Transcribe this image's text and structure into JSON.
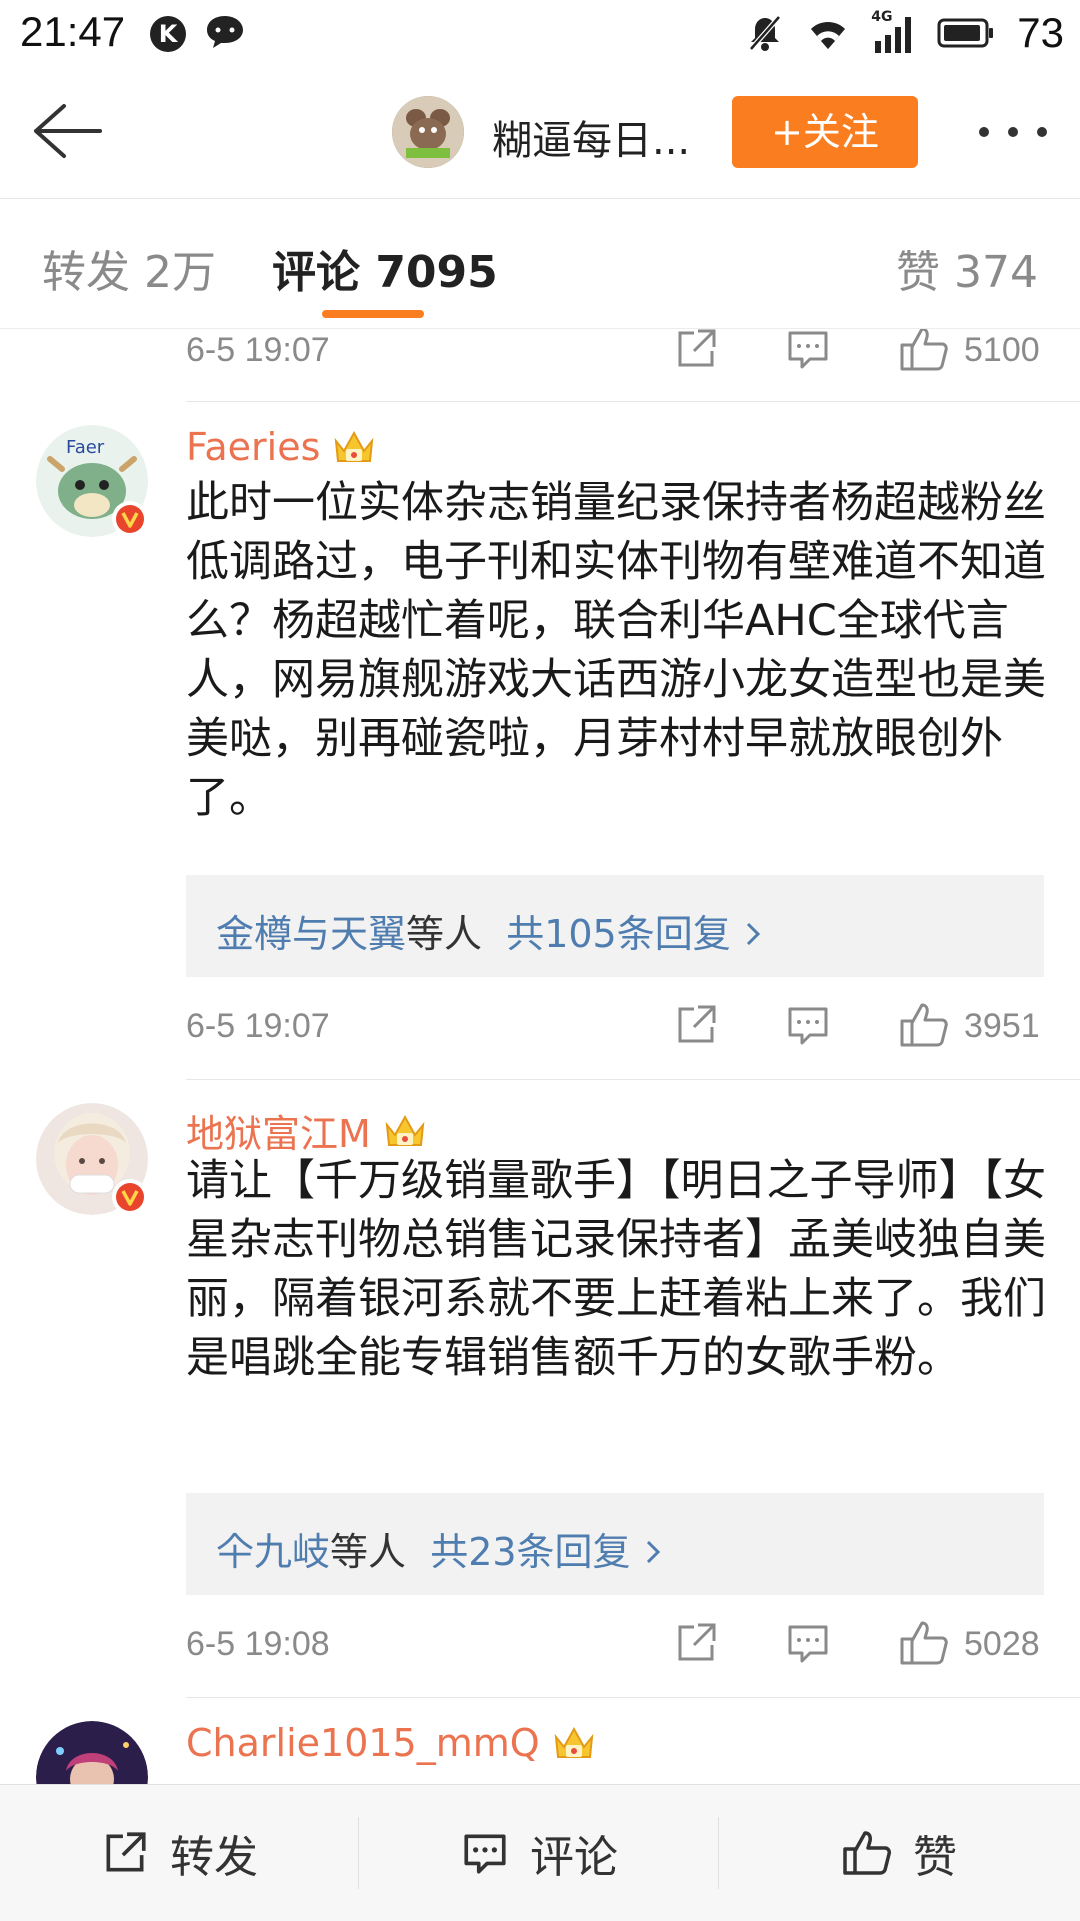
{
  "status_bar": {
    "time": "21:47",
    "k_icon_label": "K",
    "network": "4G",
    "battery": "73"
  },
  "header": {
    "account_name": "糊逼每日...",
    "follow_label": "+关注"
  },
  "tabs": {
    "repost": "转发 2万",
    "comment": "评论 7095",
    "like": "赞 374"
  },
  "comments": [
    {
      "time": "6-5 19:07",
      "likes": "5100"
    },
    {
      "user": "Faeries",
      "text": "此时一位实体杂志销量纪录保持者杨超越粉丝低调路过，电子刊和实体刊物有壁难道不知道么？杨超越忙着呢，联合利华AHC全球代言人，网易旗舰游戏大话西游小龙女造型也是美美哒，别再碰瓷啦，月芽村村早就放眼创外了。",
      "reply_names": "金樽与天翼",
      "reply_mid": "等人",
      "reply_count": "共105条回复",
      "time": "6-5 19:07",
      "likes": "3951"
    },
    {
      "user": "地狱富江M",
      "text": "请让【千万级销量歌手】【明日之子导师】【女星杂志刊物总销售记录保持者】孟美岐独自美丽，隔着银河系就不要上赶着粘上来了。我们是唱跳全能专辑销售额千万的女歌手粉。",
      "reply_names": "仐九岐",
      "reply_mid": "等人",
      "reply_count": "共23条回复",
      "time": "6-5 19:08",
      "likes": "5028"
    },
    {
      "user": "Charlie1015_mmQ"
    }
  ],
  "bottom_bar": {
    "repost": "转发",
    "comment": "评论",
    "like": "赞"
  },
  "colors": {
    "accent_orange": "#fa7d1f",
    "username_orange": "#eb7350",
    "link_blue": "#507daf",
    "verify_red": "#e8452c"
  }
}
